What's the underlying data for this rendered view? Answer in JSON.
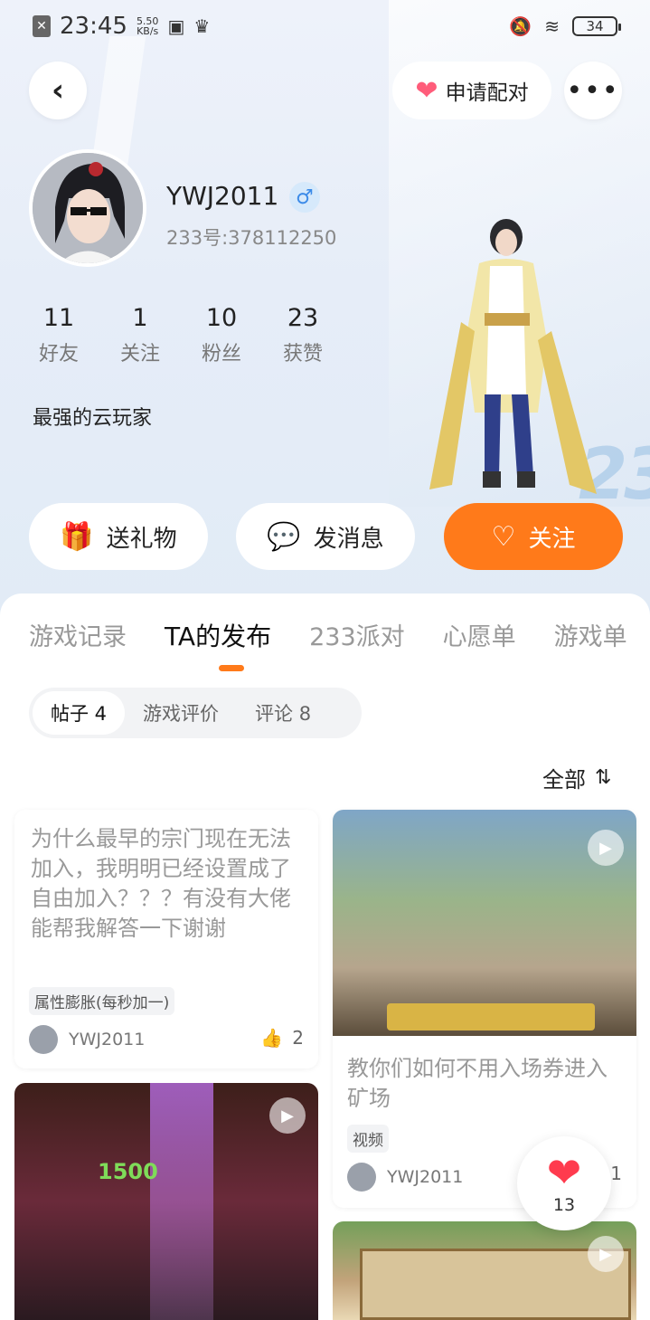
{
  "status_bar": {
    "time": "23:45",
    "speed_value": "5.50",
    "speed_unit": "KB/s",
    "battery": "34"
  },
  "nav": {
    "match_label": "申请配对",
    "more_label": "•••"
  },
  "profile": {
    "username": "YWJ2011",
    "gender_symbol": "♂",
    "user_id": "233号:378112250",
    "bio": "最强的云玩家",
    "stats": [
      {
        "value": "11",
        "label": "好友"
      },
      {
        "value": "1",
        "label": "关注"
      },
      {
        "value": "10",
        "label": "粉丝"
      },
      {
        "value": "23",
        "label": "获赞"
      }
    ]
  },
  "actions": {
    "gift_label": "送礼物",
    "message_label": "发消息",
    "follow_label": "关注"
  },
  "tabs": [
    {
      "label": "游戏记录"
    },
    {
      "label": "TA的发布"
    },
    {
      "label": "233派对"
    },
    {
      "label": "心愿单"
    },
    {
      "label": "游戏单"
    }
  ],
  "subtabs": [
    {
      "label": "帖子 4"
    },
    {
      "label": "游戏评价"
    },
    {
      "label": "评论 8"
    }
  ],
  "sort_label": "全部",
  "posts": [
    {
      "text": "为什么最早的宗门现在无法加入，我明明已经设置成了自由加入？？？有没有大佬能帮我解答一下谢谢",
      "tag": "属性膨胀(每秒加一)",
      "author": "YWJ2011",
      "likes": "2"
    },
    {
      "title": "教你们如何不用入场券进入矿场",
      "tag": "视频",
      "author": "YWJ2011",
      "likes": "1"
    }
  ],
  "thumb2_number": "1500",
  "floating_like_count": "13"
}
